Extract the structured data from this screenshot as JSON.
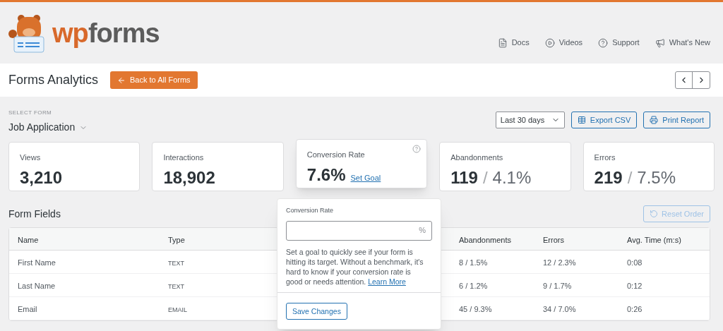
{
  "header": {
    "logo": {
      "part_1": "wp",
      "part_2": "forms"
    },
    "links": [
      {
        "kind": "doc",
        "label": "Docs"
      },
      {
        "kind": "video",
        "label": "Videos"
      },
      {
        "kind": "help",
        "label": "Support"
      },
      {
        "kind": "megaphone",
        "label": "What's New"
      }
    ]
  },
  "title_bar": {
    "title": "Forms Analytics",
    "back_button": "Back to All Forms"
  },
  "select_form": {
    "label": "SELECT FORM",
    "value": "Job Application"
  },
  "toolbar": {
    "range": "Last 30 days",
    "export": "Export CSV",
    "print": "Print Report"
  },
  "stats": [
    {
      "label": "Views",
      "value": "3,210",
      "raised": false
    },
    {
      "label": "Interactions",
      "value": "18,902",
      "raised": false
    },
    {
      "label": "Conversion Rate",
      "value": "7.6%",
      "link": "Set Goal",
      "raised": true
    },
    {
      "label": "Abandonments",
      "value": "119",
      "separator": "/",
      "percent": "4.1%",
      "raised": false
    },
    {
      "label": "Errors",
      "value": "219",
      "separator": "/",
      "percent": "7.5%",
      "raised": false
    }
  ],
  "form_fields": {
    "title": "Form Fields",
    "reset": "Reset Order",
    "columns": [
      "Name",
      "Type",
      null,
      "Abandonments",
      "Errors",
      "Avg. Time (m:s)"
    ],
    "rows": [
      [
        "First Name",
        "TEXT",
        null,
        "8 / 1.5%",
        "12 / 2.3%",
        "0:08"
      ],
      [
        "Last Name",
        "TEXT",
        null,
        "6 / 1.2%",
        "9 / 1.7%",
        "0:12"
      ],
      [
        "Email",
        "EMAIL",
        null,
        "45 / 9.3%",
        "34 / 7.0%",
        "0:26"
      ]
    ]
  },
  "popover": {
    "label": "Conversion Rate",
    "suffix": "%",
    "text": "Set a goal to quickly see if your form is hitting its target. Without a benchmark, it's hard to know if your conversion rate is good or needs attention.",
    "link": "Learn More",
    "button": "Save Changes"
  }
}
